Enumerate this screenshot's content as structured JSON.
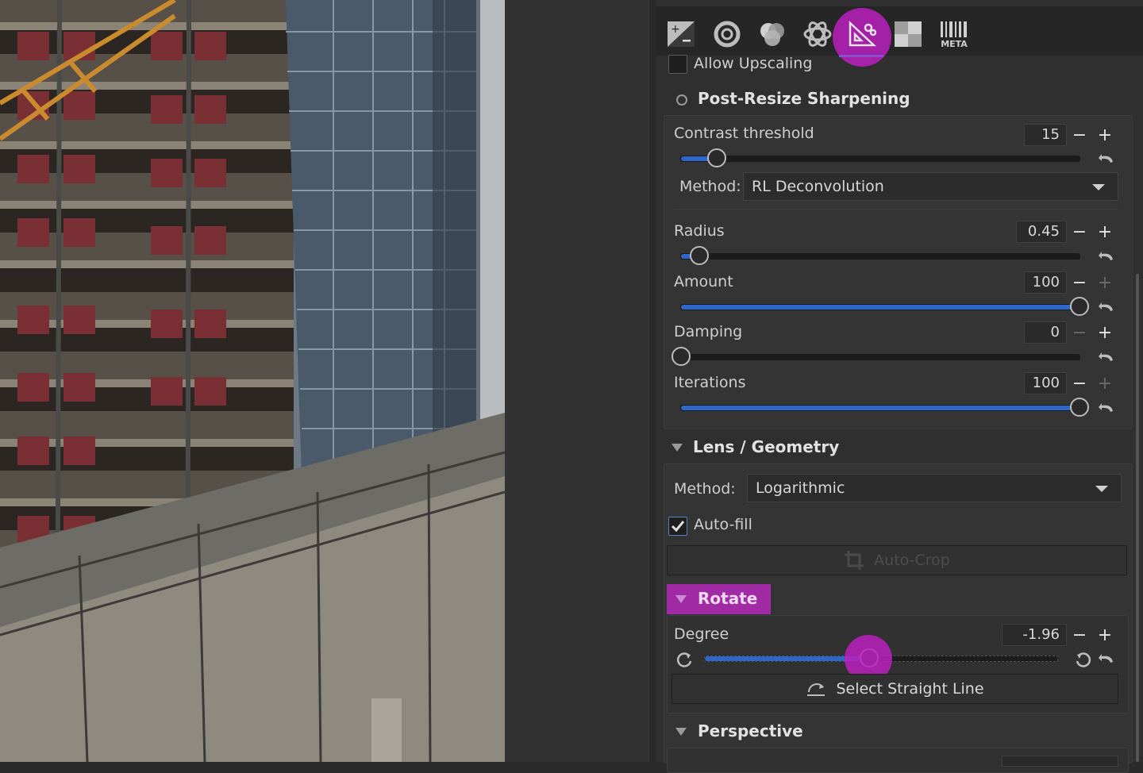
{
  "colors": {
    "accent": "#2d67c9",
    "highlight": "#b420be",
    "section_header": "#a12ba4"
  },
  "toolbar": {
    "tabs": [
      {
        "name": "exposure-tab",
        "icon": "exposure-icon"
      },
      {
        "name": "details-tab",
        "icon": "details-icon"
      },
      {
        "name": "color-tab",
        "icon": "color-icon"
      },
      {
        "name": "advanced-tab",
        "icon": "atom-icon"
      },
      {
        "name": "transform-tab",
        "icon": "transform-icon",
        "active": true
      },
      {
        "name": "raw-tab",
        "icon": "raw-icon"
      },
      {
        "name": "metadata-tab",
        "icon": "metadata-icon",
        "label": "META"
      }
    ]
  },
  "resize": {
    "allow_upscaling_label": "Allow Upscaling",
    "allow_upscaling": false
  },
  "post_resize_sharpening": {
    "title": "Post-Resize Sharpening",
    "contrast_threshold": {
      "label": "Contrast threshold",
      "value": "15",
      "fraction": 0.09
    },
    "method_label": "Method:",
    "method_value": "RL Deconvolution",
    "radius": {
      "label": "Radius",
      "value": "0.45",
      "fraction": 0.045
    },
    "amount": {
      "label": "Amount",
      "value": "100",
      "fraction": 1.0
    },
    "damping": {
      "label": "Damping",
      "value": "0",
      "fraction": 0.0
    },
    "iterations": {
      "label": "Iterations",
      "value": "100",
      "fraction": 1.0
    }
  },
  "lens_geometry": {
    "title": "Lens / Geometry",
    "method_label": "Method:",
    "method_value": "Logarithmic",
    "autofill_label": "Auto-fill",
    "autofill": true,
    "autocrop_label": "Auto-Crop"
  },
  "rotate": {
    "title": "Rotate",
    "degree": {
      "label": "Degree",
      "value": "-1.96",
      "fraction": 0.467
    },
    "select_line_label": "Select Straight Line"
  },
  "perspective": {
    "title": "Perspective"
  }
}
